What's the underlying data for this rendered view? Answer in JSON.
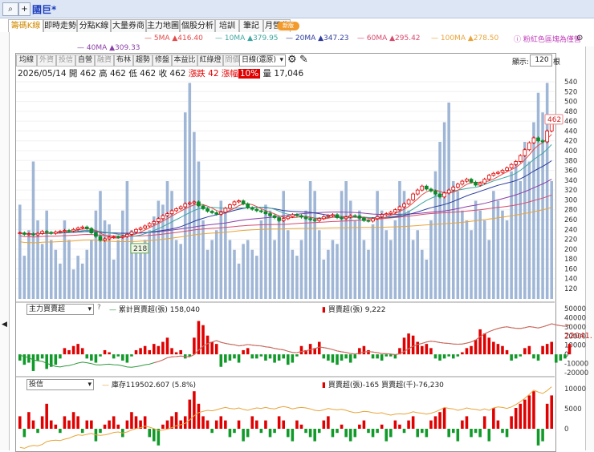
{
  "window": {
    "stock_name": "國巨*",
    "zoom_icon": "magnifier-icon",
    "plus_label": "+"
  },
  "tabs": [
    {
      "label": "籌碼K線",
      "active": true
    },
    {
      "label": "即時走勢",
      "active": false
    },
    {
      "label": "分點K線",
      "active": false
    },
    {
      "label": "大量券商",
      "active": false
    },
    {
      "label": "主力地圖",
      "active": false
    },
    {
      "label": "個股分析",
      "active": false
    },
    {
      "label": "培訓",
      "active": false
    },
    {
      "label": "筆記",
      "active": false
    },
    {
      "label": "月營收",
      "active": false
    }
  ],
  "new_badge": "新版",
  "ma_legend": [
    {
      "label": "5MA ▲416.40",
      "color": "#e24a4a"
    },
    {
      "label": "10MA ▲379.95",
      "color": "#3fa6a0"
    },
    {
      "label": "20MA ▲347.23",
      "color": "#2c3d9c"
    },
    {
      "label": "60MA ▲295.42",
      "color": "#d64a6e"
    },
    {
      "label": "100MA ▲278.50",
      "color": "#e8a43a"
    },
    {
      "label": "40MA ▲309.33",
      "color": "#8a3fa6"
    }
  ],
  "hint": "粉紅色區塊為僅營",
  "toolbar": {
    "buttons": [
      "均線",
      "外資",
      "投信",
      "自營",
      "融資",
      "布林",
      "趨勢",
      "修盤",
      "本益比",
      "紅綠燈",
      "問價量"
    ],
    "period": "日線(還原)",
    "display_label": "顯示:",
    "display_value": "120",
    "display_unit": "根"
  },
  "quote": {
    "date": "2026/05/14",
    "open": "開 462",
    "high": "高 462",
    "low": "低 462",
    "close": "收 462",
    "change": "漲跌 42",
    "change_pct_label": "漲幅",
    "change_pct": "10%",
    "volume": "量 17,046"
  },
  "price_axis": [
    "540",
    "520",
    "500",
    "480",
    "460",
    "440",
    "420",
    "400",
    "380",
    "360",
    "340",
    "320",
    "300",
    "280",
    "260",
    "240",
    "220",
    "200",
    "180",
    "160",
    "140",
    "120"
  ],
  "price_marker": "462",
  "low_marker": "218",
  "panel2": {
    "select": "主力買賣超",
    "help": "?",
    "legend1": "累計買賣超(張) 158,040",
    "legend2": "買賣超(張) 9,222",
    "value_tag": "22041.",
    "axis": [
      "50000",
      "40000",
      "30000",
      "20000",
      "10000",
      "0",
      "-10000",
      "-20000"
    ]
  },
  "panel3": {
    "select": "投信",
    "legend1": "庫存119502.607 (5.8%)",
    "legend2": "買賣超(張)-165 買賣超(千)-76,230",
    "axis": [
      "10000",
      "5000",
      "0"
    ]
  },
  "chart_data": {
    "type": "candlestick",
    "ylim": [
      110,
      550
    ],
    "close_last": 462,
    "ma": {
      "5MA": 416.4,
      "10MA": 379.95,
      "20MA": 347.23,
      "40MA": 309.33,
      "60MA": 295.42,
      "100MA": 278.5
    },
    "volume_series": [
      48,
      22,
      35,
      70,
      40,
      28,
      45,
      30,
      25,
      18,
      40,
      30,
      15,
      22,
      18,
      25,
      30,
      45,
      55,
      40,
      38,
      20,
      30,
      45,
      60,
      35,
      25,
      28,
      30,
      35,
      42,
      50,
      48,
      60,
      55,
      30,
      28,
      95,
      110,
      85,
      70,
      40,
      25,
      30,
      35,
      50,
      45,
      30,
      25,
      18,
      28,
      30,
      25,
      22,
      40,
      48,
      45,
      30,
      40,
      55,
      35,
      25,
      22,
      30,
      45,
      60,
      55,
      35,
      20,
      25,
      30,
      28,
      55,
      60,
      50,
      40,
      45,
      30,
      25,
      38,
      55,
      45,
      35,
      30,
      40,
      60,
      55,
      45,
      30,
      35,
      25,
      20,
      40,
      65,
      80,
      90,
      100,
      60,
      55,
      45,
      40,
      35,
      50,
      45,
      40,
      30,
      55,
      50,
      45,
      40,
      65,
      70,
      60,
      80,
      70,
      90,
      105,
      95,
      110,
      60
    ],
    "close_series": [
      233,
      230,
      231,
      229,
      232,
      236,
      234,
      232,
      235,
      236,
      238,
      237,
      240,
      243,
      245,
      242,
      233,
      226,
      218,
      221,
      224,
      225,
      224,
      226,
      230,
      235,
      240,
      243,
      247,
      252,
      256,
      262,
      268,
      272,
      278,
      282,
      286,
      292,
      294,
      296,
      288,
      282,
      277,
      274,
      271,
      275,
      283,
      290,
      296,
      298,
      292,
      284,
      281,
      278,
      276,
      272,
      268,
      264,
      258,
      262,
      266,
      270,
      268,
      265,
      262,
      260,
      258,
      262,
      266,
      268,
      270,
      264,
      262,
      265,
      268,
      267,
      263,
      258,
      257,
      262,
      266,
      270,
      272,
      275,
      280,
      286,
      292,
      300,
      312,
      320,
      328,
      322,
      318,
      312,
      306,
      314,
      320,
      326,
      332,
      338,
      342,
      336,
      330,
      334,
      342,
      350,
      354,
      356,
      360,
      365,
      372,
      378,
      390,
      402,
      416,
      426,
      420,
      418,
      440,
      462
    ],
    "inst_net": [
      -3,
      -5,
      -4,
      -8,
      -3,
      -2,
      -7,
      -6,
      -5,
      -2,
      3,
      2,
      4,
      5,
      3,
      -2,
      -3,
      -4,
      -1,
      2,
      1,
      -2,
      -1,
      -3,
      -4,
      -1,
      2,
      3,
      4,
      2,
      5,
      4,
      6,
      8,
      3,
      1,
      2,
      -2,
      -1,
      8,
      16,
      14,
      9,
      6,
      5,
      -6,
      -4,
      -3,
      -2,
      -4,
      2,
      3,
      -2,
      -2,
      -1,
      -3,
      -2,
      -4,
      -3,
      -2,
      -5,
      -4,
      -1,
      4,
      2,
      5,
      3,
      6,
      -2,
      -3,
      -4,
      -5,
      -3,
      -2,
      -4,
      -2,
      3,
      4,
      2,
      -2,
      -2,
      -3,
      -1,
      -1,
      -2,
      3,
      8,
      10,
      9,
      6,
      4,
      5,
      3,
      -2,
      -3,
      -2,
      -1,
      -2,
      -1,
      1,
      3,
      4,
      7,
      12,
      10,
      8,
      6,
      5,
      4,
      2,
      -3,
      -2,
      -1,
      3,
      4,
      -2,
      -3,
      4,
      5,
      6,
      -4,
      -3,
      -2,
      5
    ],
    "trust_net": [
      3,
      -2,
      4,
      2,
      -1,
      3,
      6,
      2,
      1,
      -1,
      3,
      2,
      4,
      3,
      -1,
      2,
      2,
      -3,
      -1,
      1,
      2,
      3,
      1,
      -2,
      2,
      4,
      3,
      2,
      3,
      -2,
      -3,
      -4,
      1,
      2,
      3,
      4,
      2,
      3,
      7,
      9,
      6,
      3,
      2,
      -1,
      2,
      3,
      2,
      -2,
      -1,
      2,
      -3,
      -2,
      3,
      2,
      -1,
      2,
      -2,
      -1,
      3,
      2,
      -2,
      -3,
      2,
      1,
      -1,
      -2,
      -3,
      -1,
      2,
      3,
      -2,
      -1,
      1,
      -2,
      -3,
      -2,
      1,
      2,
      -1,
      -2,
      -1,
      1,
      -3,
      -2,
      2,
      1,
      -1,
      2,
      3,
      -2,
      -1,
      -2,
      2,
      3,
      4,
      5,
      -2,
      -1,
      -3,
      2,
      3,
      -2,
      -1,
      -2,
      3,
      -3,
      5,
      2,
      -1,
      -2,
      3,
      5,
      6,
      7,
      8,
      9,
      -4,
      -3,
      6,
      8
    ]
  }
}
